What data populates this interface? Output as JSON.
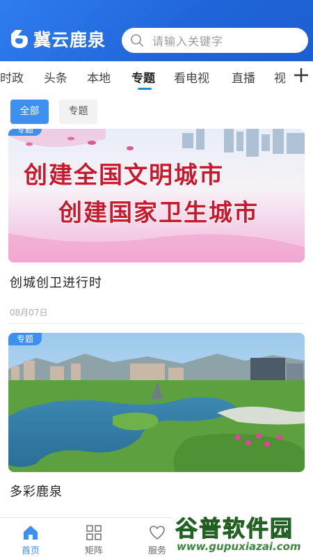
{
  "header": {
    "app_name": "冀云鹿泉",
    "search_placeholder": "请输入关键字"
  },
  "tabs": [
    {
      "label": "时政",
      "active": false
    },
    {
      "label": "头条",
      "active": false
    },
    {
      "label": "本地",
      "active": false
    },
    {
      "label": "专题",
      "active": true
    },
    {
      "label": "看电视",
      "active": false
    },
    {
      "label": "直播",
      "active": false
    },
    {
      "label": "视",
      "active": false
    }
  ],
  "filters": {
    "all_label": "全部",
    "topic_label": "专题"
  },
  "cards": [
    {
      "tag": "专题",
      "title": "创城创卫进行时",
      "date": "08月07日",
      "banner_line1": "创建全国文明城市",
      "banner_line2": "创建国家卫生城市"
    },
    {
      "tag": "专题",
      "title": "多彩鹿泉",
      "date": ""
    }
  ],
  "bottom_nav": [
    {
      "label": "首页",
      "icon": "home-icon",
      "active": true
    },
    {
      "label": "矩阵",
      "icon": "grid-icon",
      "active": false
    },
    {
      "label": "服务",
      "icon": "heart-icon",
      "active": false
    }
  ],
  "watermark": {
    "big": "谷普软件园",
    "small": "www.gupuxiazai.com"
  },
  "colors": {
    "header_blue": "#1f64d8",
    "accent": "#3d8ff0",
    "underline": "#1d8bd8"
  }
}
